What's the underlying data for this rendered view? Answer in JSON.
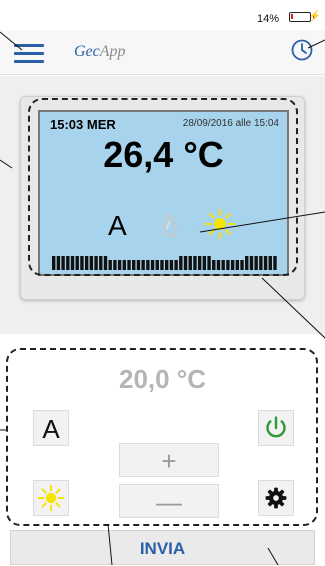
{
  "status_bar": {
    "battery_percent": "14%",
    "battery_level": 0.14,
    "battery_color": "#e0161a"
  },
  "header": {
    "brand_prefix": "Gec",
    "brand_suffix": "App",
    "brand_prefix_color": "#2a60a8",
    "brand_suffix_color": "#8a8a8a",
    "menu_icon": "hamburger-menu-icon",
    "history_icon": "clock-icon"
  },
  "display": {
    "time_day": "15:03 MER",
    "last_update": "28/09/2016 alle 15:04",
    "current_temperature": "26,4 °C",
    "mode_letter": "A",
    "drop_icon": "water-drop-icon",
    "season_icon": "sun-icon",
    "bars_icon": "program-bars-icon",
    "lcd_color": "#a8d3ec"
  },
  "controls": {
    "setpoint": "20,0 °C",
    "mode_button_label": "A",
    "plus_label": "+",
    "minus_label": "—",
    "power_icon": "power-icon",
    "power_color": "#2e9a3a",
    "season_button_icon": "sun-icon",
    "settings_icon": "gear-icon",
    "send_label": "INVIA"
  },
  "accent_color": "#2a60a8"
}
